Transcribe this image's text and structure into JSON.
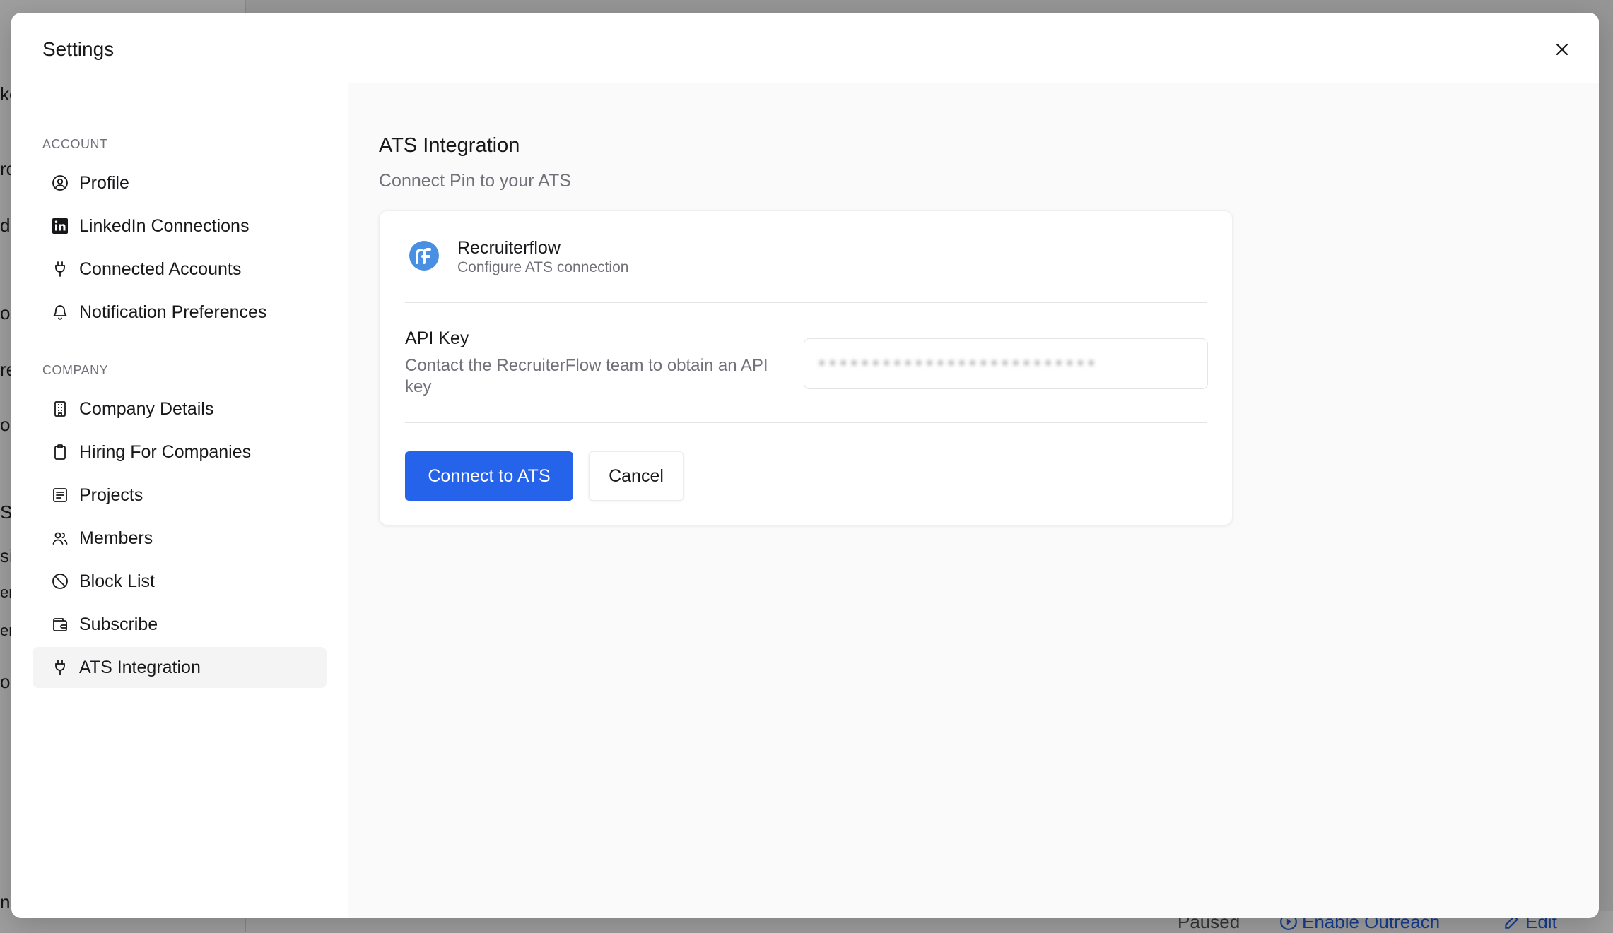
{
  "background": {
    "left_fragments": [
      "ke",
      "rc",
      "d",
      "ox",
      "re",
      "o",
      "S",
      "sit",
      "er",
      "er",
      "or",
      "n"
    ],
    "bottom_texts": [
      "Paused",
      "Enable Outreach",
      "Edit"
    ]
  },
  "modal": {
    "title": "Settings",
    "close_icon": "close-icon"
  },
  "sidebar": {
    "account_label": "ACCOUNT",
    "company_label": "COMPANY",
    "account_items": [
      {
        "label": "Profile",
        "icon": "user-circle-icon"
      },
      {
        "label": "LinkedIn Connections",
        "icon": "linkedin-icon"
      },
      {
        "label": "Connected Accounts",
        "icon": "plug-icon"
      },
      {
        "label": "Notification Preferences",
        "icon": "bell-icon"
      }
    ],
    "company_items": [
      {
        "label": "Company Details",
        "icon": "building-icon"
      },
      {
        "label": "Hiring For Companies",
        "icon": "clipboard-icon"
      },
      {
        "label": "Projects",
        "icon": "list-icon"
      },
      {
        "label": "Members",
        "icon": "users-icon"
      },
      {
        "label": "Block List",
        "icon": "ban-icon"
      },
      {
        "label": "Subscribe",
        "icon": "wallet-icon"
      },
      {
        "label": "ATS Integration",
        "icon": "plug-icon",
        "active": true
      }
    ]
  },
  "content": {
    "title": "ATS Integration",
    "subtitle": "Connect Pin to your ATS",
    "provider": {
      "name": "Recruiterflow",
      "description": "Configure ATS connection",
      "logo": "recruiterflow-logo"
    },
    "api_key": {
      "label": "API Key",
      "help": "Contact the RecruiterFlow team to obtain an API key",
      "value": "••••••••••••••••••••••••••"
    },
    "buttons": {
      "connect": "Connect to ATS",
      "cancel": "Cancel"
    }
  },
  "colors": {
    "accent": "#2563eb",
    "logo_blue": "#4a90e2"
  }
}
